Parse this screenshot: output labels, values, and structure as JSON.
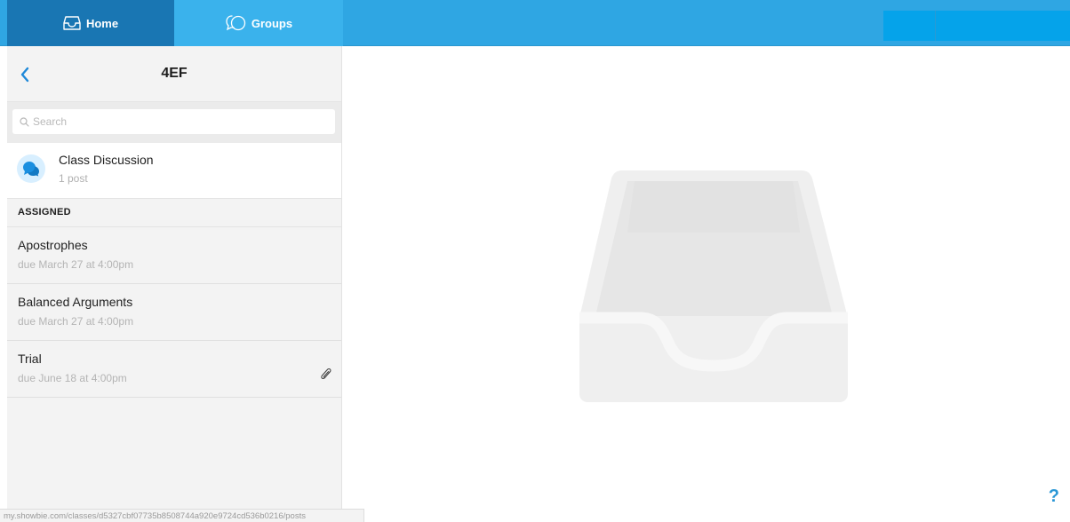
{
  "nav": {
    "home_label": "Home",
    "groups_label": "Groups"
  },
  "sidebar": {
    "title": "4EF",
    "search_placeholder": "Search",
    "class_discussion": {
      "name": "Class Discussion",
      "count": "1 post"
    },
    "section_label": "ASSIGNED",
    "items": [
      {
        "name": "Apostrophes",
        "due": "due March 27 at 4:00pm",
        "attachment": false
      },
      {
        "name": "Balanced Arguments",
        "due": "due March 27 at 4:00pm",
        "attachment": false
      },
      {
        "name": "Trial",
        "due": "due June 18 at 4:00pm",
        "attachment": true
      }
    ]
  },
  "status_url": "my.showbie.com/classes/d5327cbf07735b8508744a920e9724cd536b0216/posts",
  "help_label": "?",
  "colors": {
    "topbar": "#2fa6e3",
    "home_tab": "#1976b3",
    "accent": "#2a97d6"
  }
}
